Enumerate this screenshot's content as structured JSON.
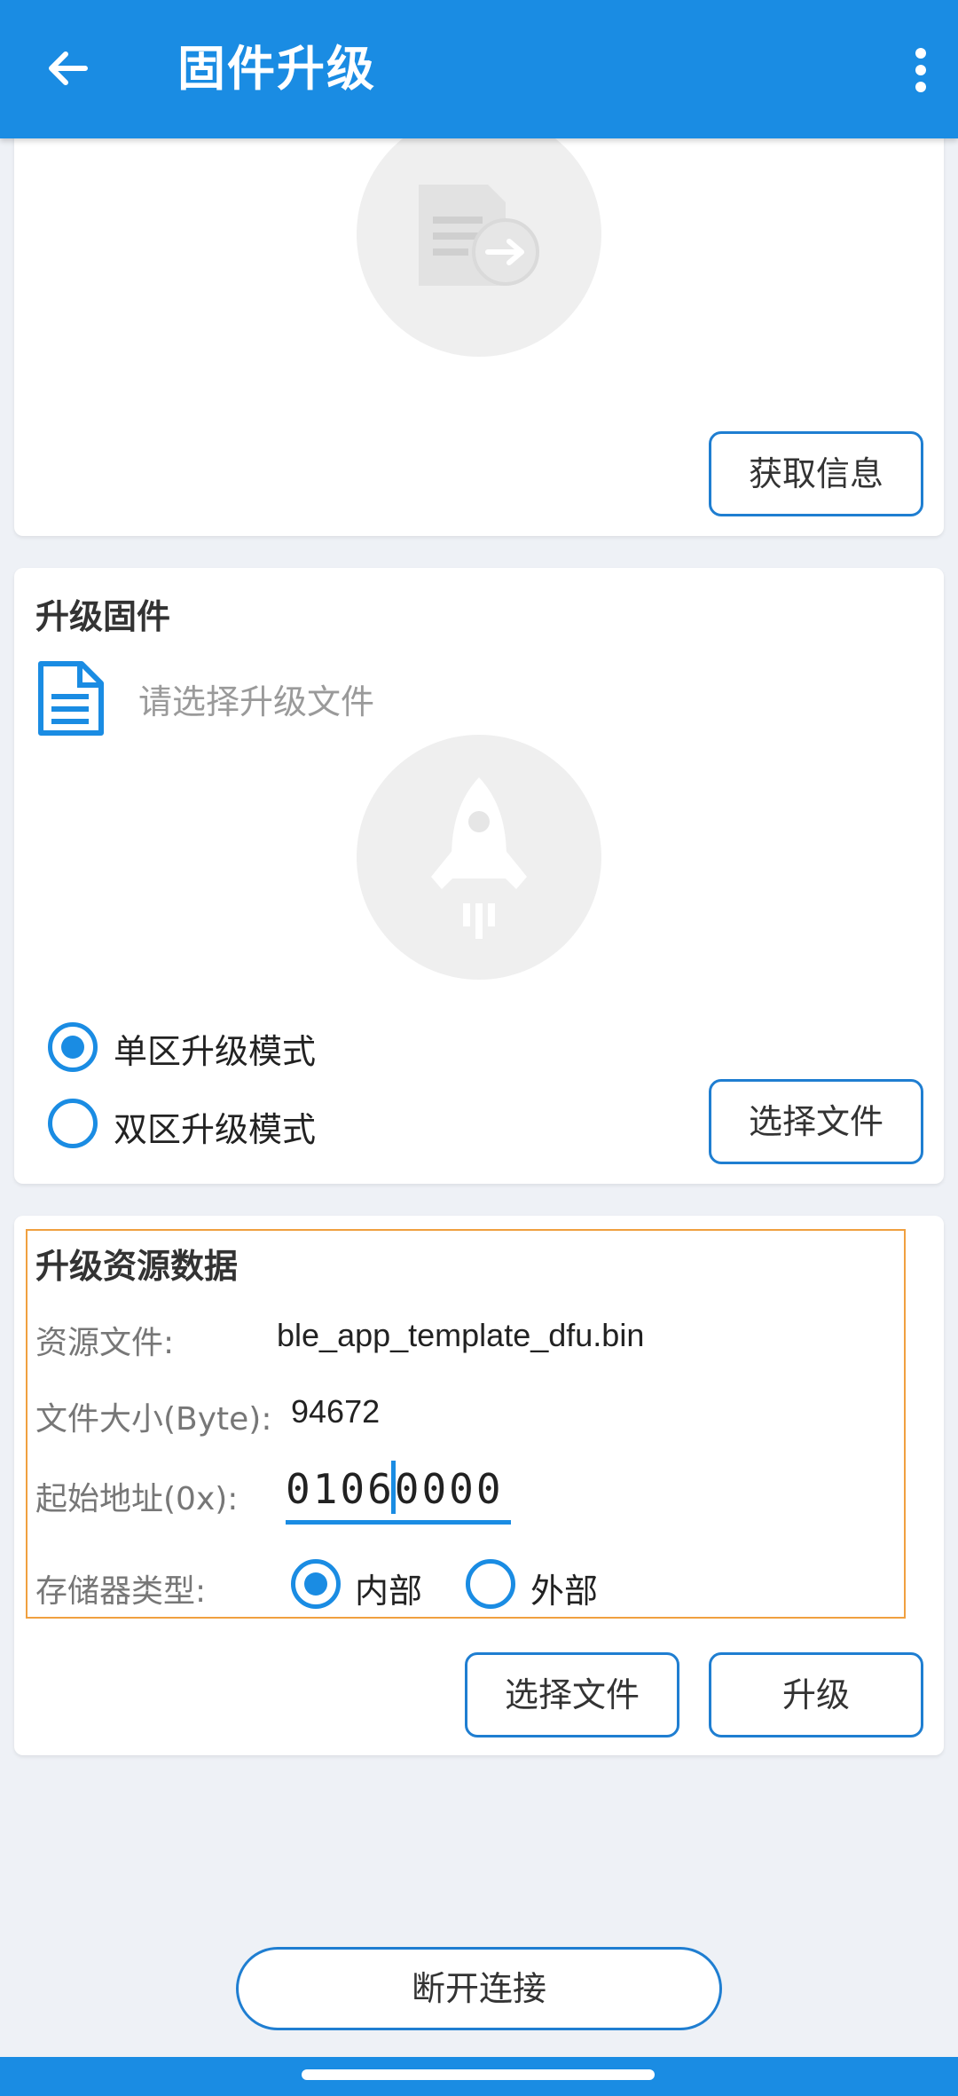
{
  "appbar": {
    "title": "固件升级",
    "back_icon": "arrow-left-icon",
    "menu_icon": "more-vert-icon"
  },
  "info_card": {
    "illustration_icon": "document-transfer-icon",
    "get_info_button": "获取信息"
  },
  "upgrade_card": {
    "title": "升级固件",
    "file_icon": "document-icon",
    "file_hint": "请选择升级文件",
    "illustration_icon": "rocket-icon",
    "modes": [
      {
        "label": "单区升级模式",
        "checked": true
      },
      {
        "label": "双区升级模式",
        "checked": false
      }
    ],
    "select_file_button": "选择文件"
  },
  "resource_card": {
    "title": "升级资源数据",
    "file_label": "资源文件:",
    "file_value": "ble_app_template_dfu.bin",
    "size_label": "文件大小(Byte):",
    "size_value": "94672",
    "addr_label": "起始地址(0x):",
    "addr_value": "01060000",
    "storage_label": "存储器类型:",
    "storage_options": [
      {
        "label": "内部",
        "checked": true
      },
      {
        "label": "外部",
        "checked": false
      }
    ],
    "select_file_button": "选择文件",
    "upgrade_button": "升级"
  },
  "disconnect_button": "断开连接",
  "colors": {
    "primary": "#1a8ce3",
    "highlight_border": "#f0a040",
    "background": "#eef1f6"
  }
}
